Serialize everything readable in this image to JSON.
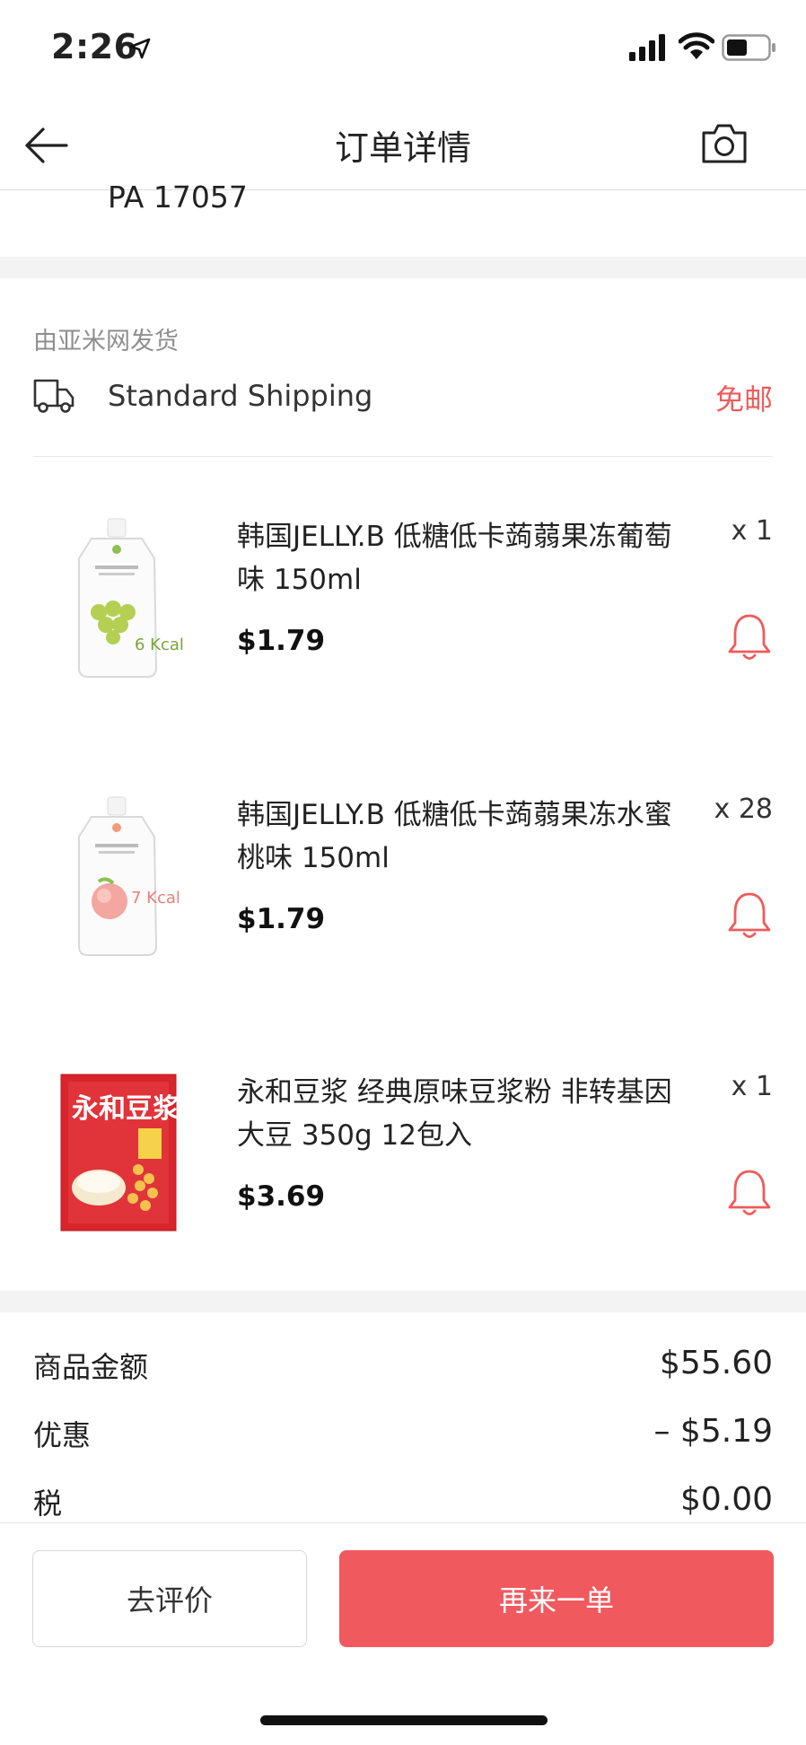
{
  "status": {
    "time": "2:26"
  },
  "nav": {
    "title": "订单详情"
  },
  "address": {
    "tail": "PA 17057"
  },
  "shipping": {
    "from": "由亚米网发货",
    "method": "Standard Shipping",
    "fee": "免邮"
  },
  "items": [
    {
      "name": "韩国JELLY.B 低糖低卡蒟蒻果冻葡萄味 150ml",
      "qty": "x 1",
      "price": "$1.79",
      "thumb_label": "6 Kcal"
    },
    {
      "name": "韩国JELLY.B 低糖低卡蒟蒻果冻水蜜桃味 150ml",
      "qty": "x 28",
      "price": "$1.79",
      "thumb_label": "7 Kcal"
    },
    {
      "name": "永和豆浆 经典原味豆浆粉 非转基因大豆 350g 12包入",
      "qty": "x 1",
      "price": "$3.69",
      "thumb_label": "永和豆浆"
    }
  ],
  "summary": [
    {
      "label": "商品金额",
      "value": "$55.60"
    },
    {
      "label": "优惠",
      "value": "– $5.19"
    },
    {
      "label": "税",
      "value": "$0.00"
    }
  ],
  "actions": {
    "review": "去评价",
    "reorder": "再来一单"
  },
  "colors": {
    "accent": "#f05a5f",
    "muted": "#8e8e8e",
    "gap": "#f3f3f3"
  }
}
